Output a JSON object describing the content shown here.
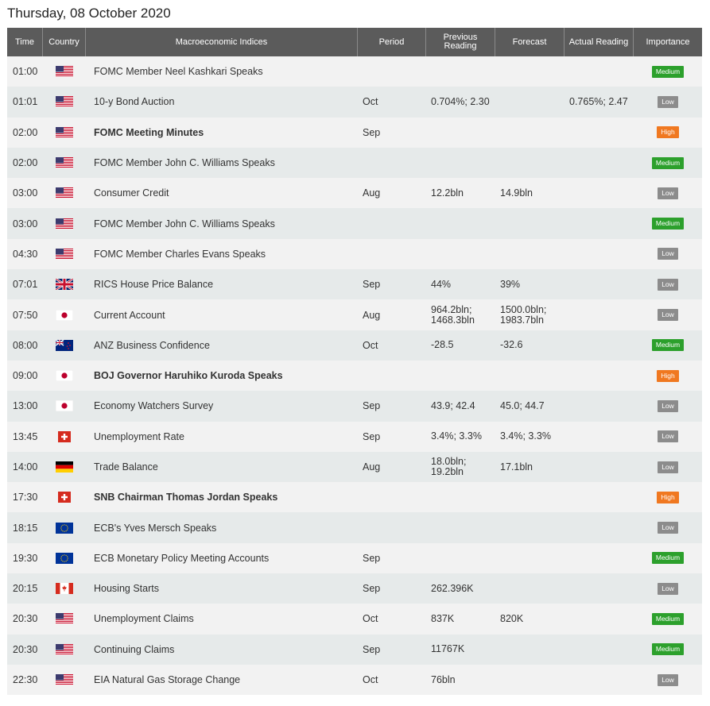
{
  "title": "Thursday, 08 October 2020",
  "headers": {
    "time": "Time",
    "country": "Country",
    "event": "Macroeconomic Indices",
    "period": "Period",
    "previous": "Previous Reading",
    "forecast": "Forecast",
    "actual": "Actual Reading",
    "importance": "Importance"
  },
  "importance_colors": {
    "Medium": "#2ca02c",
    "Low": "#8c8c8c",
    "High": "#f07820"
  },
  "rows": [
    {
      "time": "01:00",
      "flag": "us-flag-icon",
      "event": "FOMC Member Neel Kashkari Speaks",
      "bold": false,
      "period": "",
      "previous": "",
      "forecast": "",
      "actual": "",
      "importance": "Medium"
    },
    {
      "time": "01:01",
      "flag": "us-flag-icon",
      "event": "10-y Bond Auction",
      "bold": false,
      "period": "Oct",
      "previous": "0.704%; 2.30",
      "forecast": "",
      "actual": "0.765%; 2.47",
      "importance": "Low"
    },
    {
      "time": "02:00",
      "flag": "us-flag-icon",
      "event": "FOMC Meeting Minutes",
      "bold": true,
      "period": "Sep",
      "previous": "",
      "forecast": "",
      "actual": "",
      "importance": "High"
    },
    {
      "time": "02:00",
      "flag": "us-flag-icon",
      "event": "FOMC Member John C. Williams Speaks",
      "bold": false,
      "period": "",
      "previous": "",
      "forecast": "",
      "actual": "",
      "importance": "Medium"
    },
    {
      "time": "03:00",
      "flag": "us-flag-icon",
      "event": "Consumer Credit",
      "bold": false,
      "period": "Aug",
      "previous": "12.2bln",
      "forecast": "14.9bln",
      "actual": "",
      "importance": "Low"
    },
    {
      "time": "03:00",
      "flag": "us-flag-icon",
      "event": "FOMC Member John C. Williams Speaks",
      "bold": false,
      "period": "",
      "previous": "",
      "forecast": "",
      "actual": "",
      "importance": "Medium"
    },
    {
      "time": "04:30",
      "flag": "us-flag-icon",
      "event": "FOMC Member Charles Evans Speaks",
      "bold": false,
      "period": "",
      "previous": "",
      "forecast": "",
      "actual": "",
      "importance": "Low"
    },
    {
      "time": "07:01",
      "flag": "uk-flag-icon",
      "event": "RICS House Price Balance",
      "bold": false,
      "period": "Sep",
      "previous": "44%",
      "forecast": "39%",
      "actual": "",
      "importance": "Low"
    },
    {
      "time": "07:50",
      "flag": "jp-flag-icon",
      "event": "Current Account",
      "bold": false,
      "period": "Aug",
      "previous": "964.2bln; 1468.3bln",
      "forecast": "1500.0bln; 1983.7bln",
      "actual": "",
      "importance": "Low"
    },
    {
      "time": "08:00",
      "flag": "nz-flag-icon",
      "event": "ANZ Business Confidence",
      "bold": false,
      "period": "Oct",
      "previous": "-28.5",
      "forecast": "-32.6",
      "actual": "",
      "importance": "Medium"
    },
    {
      "time": "09:00",
      "flag": "jp-flag-icon",
      "event": "BOJ Governor Haruhiko Kuroda Speaks",
      "bold": true,
      "period": "",
      "previous": "",
      "forecast": "",
      "actual": "",
      "importance": "High"
    },
    {
      "time": "13:00",
      "flag": "jp-flag-icon",
      "event": "Economy Watchers Survey",
      "bold": false,
      "period": "Sep",
      "previous": "43.9; 42.4",
      "forecast": "45.0; 44.7",
      "actual": "",
      "importance": "Low"
    },
    {
      "time": "13:45",
      "flag": "ch-flag-icon",
      "event": "Unemployment Rate",
      "bold": false,
      "period": "Sep",
      "previous": "3.4%; 3.3%",
      "forecast": "3.4%; 3.3%",
      "actual": "",
      "importance": "Low"
    },
    {
      "time": "14:00",
      "flag": "de-flag-icon",
      "event": "Trade Balance",
      "bold": false,
      "period": "Aug",
      "previous": "18.0bln; 19.2bln",
      "forecast": "17.1bln",
      "actual": "",
      "importance": "Low"
    },
    {
      "time": "17:30",
      "flag": "ch-flag-icon",
      "event": "SNB Chairman Thomas Jordan Speaks",
      "bold": true,
      "period": "",
      "previous": "",
      "forecast": "",
      "actual": "",
      "importance": "High"
    },
    {
      "time": "18:15",
      "flag": "eu-flag-icon",
      "event": "ECB's Yves Mersch Speaks",
      "bold": false,
      "period": "",
      "previous": "",
      "forecast": "",
      "actual": "",
      "importance": "Low"
    },
    {
      "time": "19:30",
      "flag": "eu-flag-icon",
      "event": "ECB Monetary Policy Meeting Accounts",
      "bold": false,
      "period": "Sep",
      "previous": "",
      "forecast": "",
      "actual": "",
      "importance": "Medium"
    },
    {
      "time": "20:15",
      "flag": "ca-flag-icon",
      "event": "Housing Starts",
      "bold": false,
      "period": "Sep",
      "previous": "262.396K",
      "forecast": "",
      "actual": "",
      "importance": "Low"
    },
    {
      "time": "20:30",
      "flag": "us-flag-icon",
      "event": "Unemployment Claims",
      "bold": false,
      "period": "Oct",
      "previous": "837K",
      "forecast": "820K",
      "actual": "",
      "importance": "Medium"
    },
    {
      "time": "20:30",
      "flag": "us-flag-icon",
      "event": "Continuing Claims",
      "bold": false,
      "period": "Sep",
      "previous": "11767K",
      "forecast": "",
      "actual": "",
      "importance": "Medium"
    },
    {
      "time": "22:30",
      "flag": "us-flag-icon",
      "event": "EIA Natural Gas Storage Change",
      "bold": false,
      "period": "Oct",
      "previous": "76bln",
      "forecast": "",
      "actual": "",
      "importance": "Low"
    }
  ]
}
